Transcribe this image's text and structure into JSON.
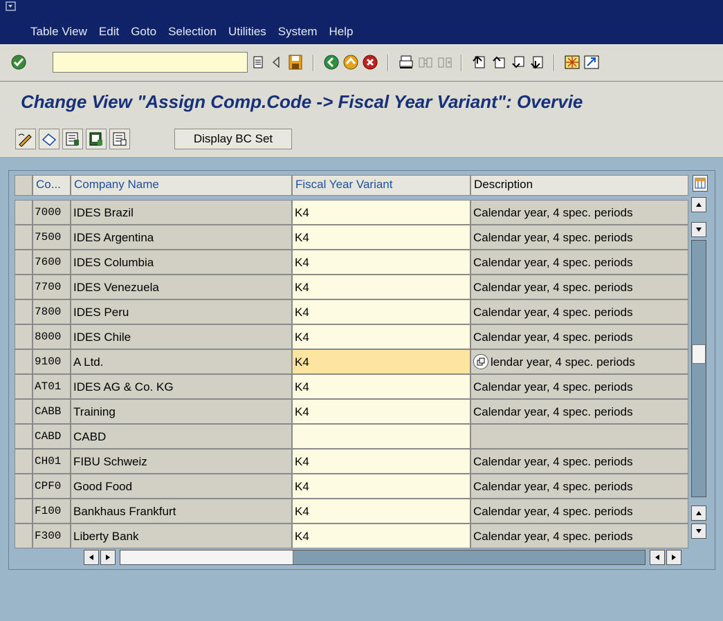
{
  "menu": [
    {
      "label": "Table View"
    },
    {
      "label": "Edit"
    },
    {
      "label": "Goto"
    },
    {
      "label": "Selection"
    },
    {
      "label": "Utilities"
    },
    {
      "label": "System"
    },
    {
      "label": "Help"
    }
  ],
  "toolbar": {
    "command_value": ""
  },
  "title": "Change View \"Assign Comp.Code -> Fiscal Year Variant\": Overvie",
  "app_toolbar": {
    "display_bc_set": "Display BC Set"
  },
  "table": {
    "headers": [
      "Co...",
      "Company Name",
      "Fiscal Year Variant",
      "Description"
    ],
    "rows": [
      {
        "code": "7000",
        "name": "IDES Brazil",
        "fyv": "K4",
        "desc": "Calendar year, 4 spec. periods"
      },
      {
        "code": "7500",
        "name": "IDES Argentina",
        "fyv": "K4",
        "desc": "Calendar year, 4 spec. periods"
      },
      {
        "code": "7600",
        "name": "IDES Columbia",
        "fyv": "K4",
        "desc": "Calendar year, 4 spec. periods"
      },
      {
        "code": "7700",
        "name": "IDES Venezuela",
        "fyv": "K4",
        "desc": "Calendar year, 4 spec. periods"
      },
      {
        "code": "7800",
        "name": "IDES Peru",
        "fyv": "K4",
        "desc": "Calendar year, 4 spec. periods"
      },
      {
        "code": "8000",
        "name": "IDES Chile",
        "fyv": "K4",
        "desc": "Calendar year, 4 spec. periods"
      },
      {
        "code": "9100",
        "name": "A Ltd.",
        "fyv": "K4",
        "desc": "lendar year, 4 spec. periods"
      },
      {
        "code": "AT01",
        "name": "IDES AG & Co. KG",
        "fyv": "K4",
        "desc": "Calendar year, 4 spec. periods"
      },
      {
        "code": "CABB",
        "name": "Training",
        "fyv": "K4",
        "desc": "Calendar year, 4 spec. periods"
      },
      {
        "code": "CABD",
        "name": "CABD",
        "fyv": "",
        "desc": ""
      },
      {
        "code": "CH01",
        "name": "FIBU Schweiz",
        "fyv": "K4",
        "desc": "Calendar year, 4 spec. periods"
      },
      {
        "code": "CPF0",
        "name": "Good Food",
        "fyv": "K4",
        "desc": "Calendar year, 4 spec. periods"
      },
      {
        "code": "F100",
        "name": "Bankhaus Frankfurt",
        "fyv": "K4",
        "desc": "Calendar year, 4 spec. periods"
      },
      {
        "code": "F300",
        "name": "Liberty Bank",
        "fyv": "K4",
        "desc": "Calendar year, 4 spec. periods"
      }
    ]
  }
}
